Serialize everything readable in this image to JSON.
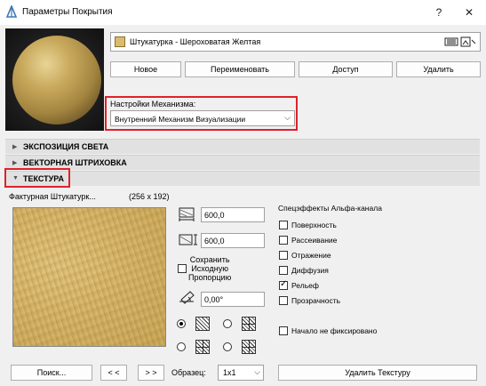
{
  "window": {
    "title": "Параметры Покрытия",
    "help_icon": "?",
    "close_icon": "✕"
  },
  "material": {
    "name": "Штукатурка - Шероховатая Желтая",
    "swatch_color": "#d9bc6e"
  },
  "buttons": {
    "new": "Новое",
    "rename": "Переименовать",
    "access": "Доступ",
    "delete": "Удалить"
  },
  "engine": {
    "label": "Настройки Механизма:",
    "value": "Внутренний Механизм Визуализации"
  },
  "sections": {
    "light": "ЭКСПОЗИЦИЯ СВЕТА",
    "hatch": "ВЕКТОРНАЯ ШТРИХОВКА",
    "texture": "ТЕКСТУРА"
  },
  "texture": {
    "name": "Фактурная Штукатурк...",
    "size": "(256 x 192)",
    "width": "600,0",
    "height": "600,0",
    "keep_proportion_line1": "Сохранить",
    "keep_proportion_line2": "Исходную",
    "keep_proportion_line3": "Пропорцию",
    "angle": "0,00°"
  },
  "alpha": {
    "title": "Спецэффекты Альфа-канала",
    "items": [
      {
        "label": "Поверхность",
        "checked": false
      },
      {
        "label": "Рассеивание",
        "checked": false
      },
      {
        "label": "Отражение",
        "checked": false
      },
      {
        "label": "Диффузия",
        "checked": false
      },
      {
        "label": "Рельеф",
        "checked": true
      },
      {
        "label": "Прозрачность",
        "checked": false
      }
    ],
    "origin_label": "Начало не фиксировано"
  },
  "bottom": {
    "search": "Поиск...",
    "prev": "< <",
    "next": "> >",
    "sample_label": "Образец:",
    "sample_value": "1x1",
    "delete_texture": "Удалить Текстуру"
  }
}
